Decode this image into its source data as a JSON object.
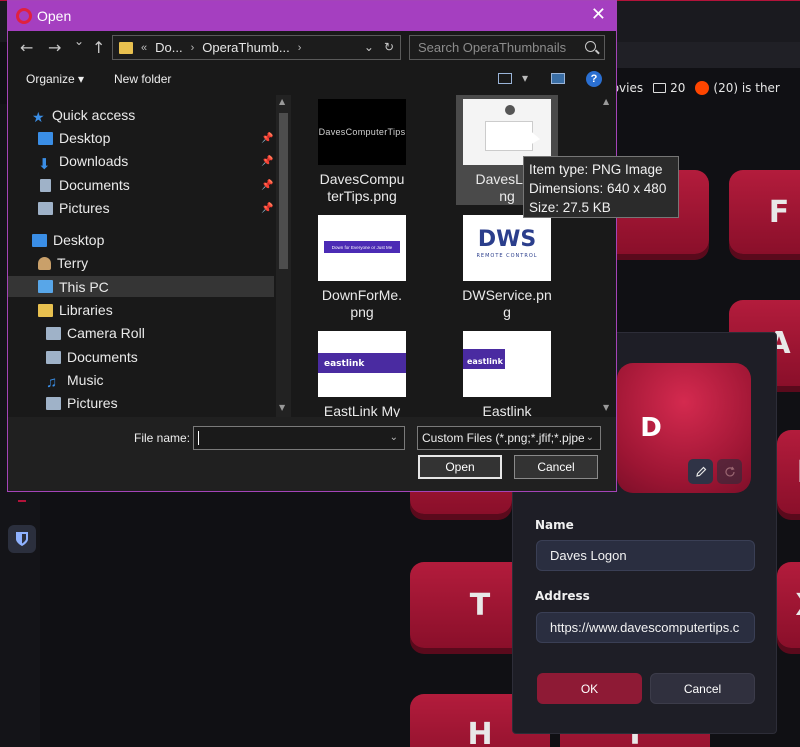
{
  "background": {
    "bookmarks": [
      {
        "label": "movies",
        "icon": "none"
      },
      {
        "label": "20",
        "icon": "folder-icon"
      },
      {
        "label": "(20) is ther",
        "icon": "reddit-icon"
      }
    ],
    "keys": {
      "letter_d": "D",
      "letter_f_top": "F",
      "letter_a": "A",
      "letter_f_mid": "F",
      "letter_t": "T",
      "letter_x": "X",
      "letter_h": "H",
      "letter_t_bottom": "T"
    },
    "accent_color": "#b31c3c"
  },
  "open_dialog": {
    "title": "Open",
    "close_glyph": "✕",
    "nav": {
      "back_glyph": "←",
      "forward_glyph": "→",
      "recent_glyph": "⌄",
      "up_glyph": "↑"
    },
    "address": {
      "prefix": "«",
      "crumbs": [
        "Do...",
        "OperaThumb..."
      ],
      "separator": "›",
      "dropdown_glyph": "⌄",
      "refresh_glyph": "↻"
    },
    "search_placeholder": "Search OperaThumbnails",
    "toolbar": {
      "organize_label": "Organize ▾",
      "new_folder_label": "New folder",
      "view_dropdown_glyph": "▾",
      "help_glyph": "?"
    },
    "nav_items": [
      {
        "label": "Quick access",
        "color": "#3a8ee6"
      },
      {
        "label": "Desktop",
        "color": "#3a8ee6"
      },
      {
        "label": "Downloads",
        "color": "#3a8ee6"
      },
      {
        "label": "Documents",
        "color": "#9fb2c8"
      },
      {
        "label": "Pictures",
        "color": "#9fb2c8"
      },
      {
        "label": "Desktop",
        "color": "#3a8ee6"
      },
      {
        "label": "Terry",
        "color": "#c9a06a"
      },
      {
        "label": "This PC",
        "color": "#58a6e8"
      },
      {
        "label": "Libraries",
        "color": "#e8c04f"
      },
      {
        "label": "Camera Roll",
        "color": "#9fb2c8"
      },
      {
        "label": "Documents",
        "color": "#9fb2c8"
      },
      {
        "label": "Music",
        "color": "#3a8ee6"
      },
      {
        "label": "Pictures",
        "color": "#9fb2c8"
      }
    ],
    "pin_glyph": "📌",
    "files": [
      {
        "line1": "DavesCompu",
        "line2": "terTips.png",
        "thumb_text": "DavesComputerTips"
      },
      {
        "line1": "DavesLog",
        "line2": "ng"
      },
      {
        "line1": "DownForMe.",
        "line2": "png",
        "thumb_text": "Down for Everyone or Just Me"
      },
      {
        "line1": "DWService.pn",
        "line2": "g",
        "thumb_text": "DWS",
        "thumb_subtext": "REMOTE CONTROL"
      },
      {
        "line1": "EastLink My",
        "line2": "",
        "thumb_text": "eastlink"
      },
      {
        "line1": "Eastlink",
        "line2": "",
        "thumb_text": "eastlink"
      }
    ],
    "tooltip": {
      "item_type": "Item type: PNG Image",
      "dimensions": "Dimensions: 640 x 480",
      "size": "Size: 27.5 KB"
    },
    "file_name_label": "File name:",
    "file_name_value": "",
    "file_type_value": "Custom Files (*.png;*.jfif;*.pjpe",
    "open_label": "Open",
    "cancel_label": "Cancel"
  },
  "edit_dialog": {
    "tile_letter": "D",
    "name_label": "Name",
    "name_value": "Daves Logon",
    "address_label": "Address",
    "address_value": "https://www.davescomputertips.c",
    "ok_label": "OK",
    "cancel_label": "Cancel"
  }
}
